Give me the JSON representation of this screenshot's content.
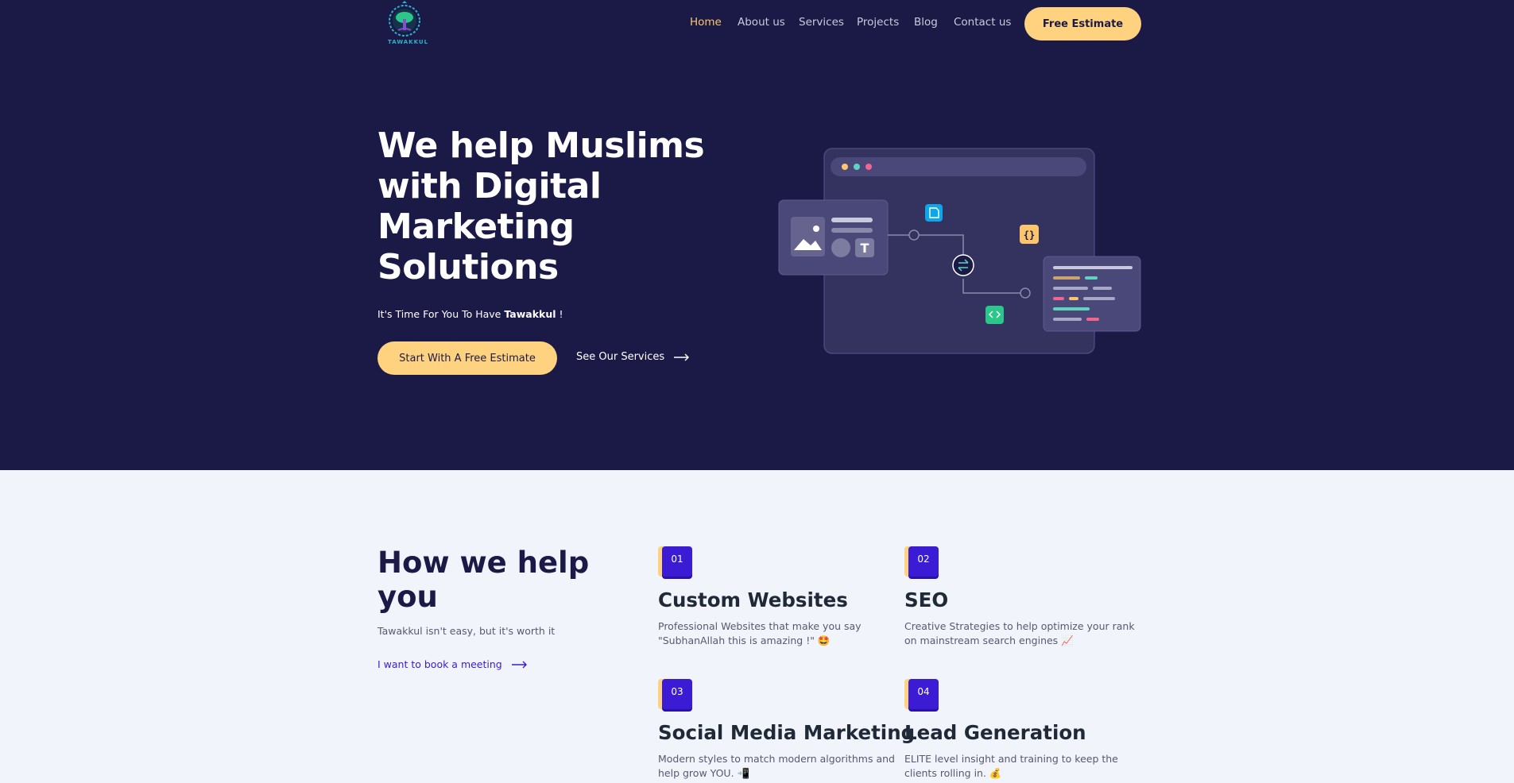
{
  "header": {
    "logo_text": "TAWAKKUL",
    "nav": [
      {
        "label": "Home",
        "active": true
      },
      {
        "label": "About us"
      },
      {
        "label": "Services"
      },
      {
        "label": "Projects"
      },
      {
        "label": "Blog"
      },
      {
        "label": "Contact us"
      }
    ],
    "cta_label": "Free Estimate"
  },
  "hero": {
    "title": "We help Muslims with Digital Marketing Solutions",
    "tagline_prefix": "It's Time For You To Have ",
    "tagline_bold": "Tawakkul",
    "tagline_suffix": " !",
    "primary_cta": "Start With A Free Estimate",
    "secondary_cta": "See Our Services"
  },
  "help": {
    "title": "How we help you",
    "subtitle": "Tawakkul isn't easy, but it's worth it",
    "link": "I want to book a meeting",
    "services": [
      {
        "number": "01",
        "title": "Custom Websites",
        "desc": "Professional Websites that make you say \"SubhanAllah this is amazing !\" 🤩"
      },
      {
        "number": "02",
        "title": "SEO",
        "desc": "Creative Strategies to help optimize your rank on mainstream search engines 📈"
      },
      {
        "number": "03",
        "title": "Social Media Marketing",
        "desc": "Modern styles to match modern algorithms and help grow YOU. 📲"
      },
      {
        "number": "04",
        "title": "Lead Generation",
        "desc": "ELITE level insight and training to keep the clients rolling in. 💰"
      }
    ]
  },
  "colors": {
    "hero_bg": "#1b1a47",
    "accent": "#fed27f",
    "brand_purple": "#3b1bd3",
    "section_bg": "#f2f4fc"
  }
}
